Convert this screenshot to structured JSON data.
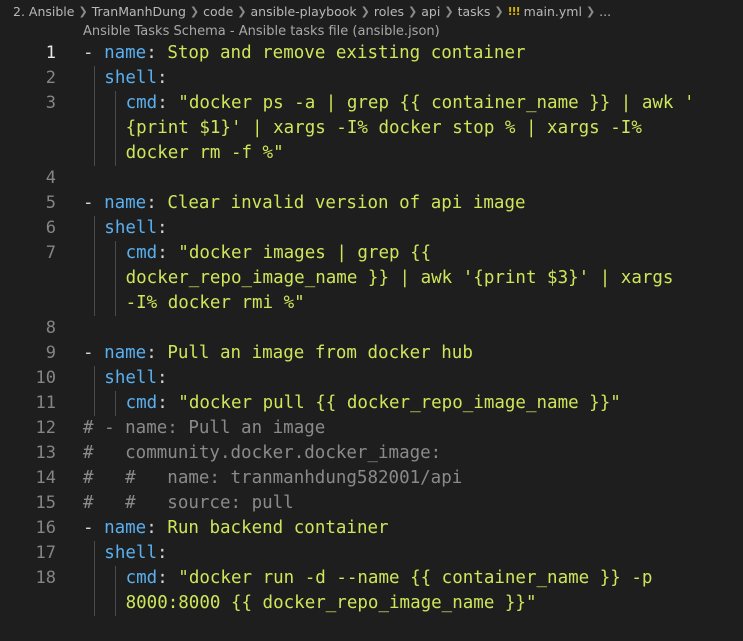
{
  "breadcrumb": {
    "items": [
      "2. Ansible",
      "TranManhDung",
      "code",
      "ansible-playbook",
      "roles",
      "api",
      "tasks"
    ],
    "file_icon": "yaml-icon",
    "file_icon_glyph": "!!!",
    "file": "main.yml",
    "more": "..."
  },
  "schema_hint": "Ansible Tasks Schema - Ansible tasks file (ansible.json)",
  "editor": {
    "active_line": 1,
    "lines": [
      {
        "n": "1",
        "text": "- name: Stop and remove existing container"
      },
      {
        "n": "2",
        "text": "shell:"
      },
      {
        "n": "3",
        "text": "cmd: \"docker ps -a | grep {{ container_name }} | awk '"
      },
      {
        "n": "",
        "text": "{print $1}' | xargs -I% docker stop % | xargs -I%"
      },
      {
        "n": "",
        "text": "docker rm -f %\""
      },
      {
        "n": "4",
        "text": ""
      },
      {
        "n": "5",
        "text": "- name: Clear invalid version of api image"
      },
      {
        "n": "6",
        "text": "shell:"
      },
      {
        "n": "7",
        "text": "cmd: \"docker images | grep {{"
      },
      {
        "n": "",
        "text": "docker_repo_image_name }} | awk '{print $3}' | xargs"
      },
      {
        "n": "",
        "text": "-I% docker rmi %\""
      },
      {
        "n": "8",
        "text": ""
      },
      {
        "n": "9",
        "text": "- name: Pull an image from docker hub"
      },
      {
        "n": "10",
        "text": "shell:"
      },
      {
        "n": "11",
        "text": "cmd: \"docker pull {{ docker_repo_image_name }}\""
      },
      {
        "n": "12",
        "text": "# - name: Pull an image"
      },
      {
        "n": "13",
        "text": "#   community.docker.docker_image:"
      },
      {
        "n": "14",
        "text": "#   #   name: tranmanhdung582001/api"
      },
      {
        "n": "15",
        "text": "#   #   source: pull"
      },
      {
        "n": "16",
        "text": "- name: Run backend container"
      },
      {
        "n": "17",
        "text": "shell:"
      },
      {
        "n": "18",
        "text": "cmd: \"docker run -d --name {{ container_name }} -p"
      },
      {
        "n": "",
        "text": "8000:8000 {{ docker_repo_image_name }}\""
      }
    ]
  },
  "colors": {
    "background": "#1e1e1e",
    "key": "#5ab0f0",
    "string": "#cde65a",
    "comment": "#8a8a8a",
    "line_number": "#858585"
  }
}
